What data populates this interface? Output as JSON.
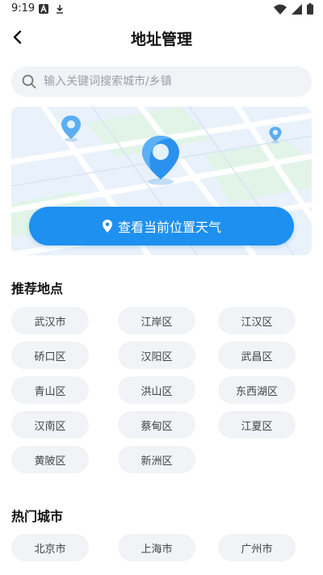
{
  "status_bar": {
    "time": "9:19"
  },
  "header": {
    "title": "地址管理"
  },
  "search": {
    "placeholder": "输入关键词搜索城市/乡镇"
  },
  "map": {
    "button_label": "查看当前位置天气",
    "accent": "#1e90f0"
  },
  "recommended": {
    "title": "推荐地点",
    "items": [
      "武汉市",
      "江岸区",
      "江汉区",
      "硚口区",
      "汉阳区",
      "武昌区",
      "青山区",
      "洪山区",
      "东西湖区",
      "汉南区",
      "蔡甸区",
      "江夏区",
      "黄陂区",
      "新洲区"
    ]
  },
  "hot_cities": {
    "title": "热门城市",
    "items": [
      "北京市",
      "上海市",
      "广州市"
    ]
  }
}
